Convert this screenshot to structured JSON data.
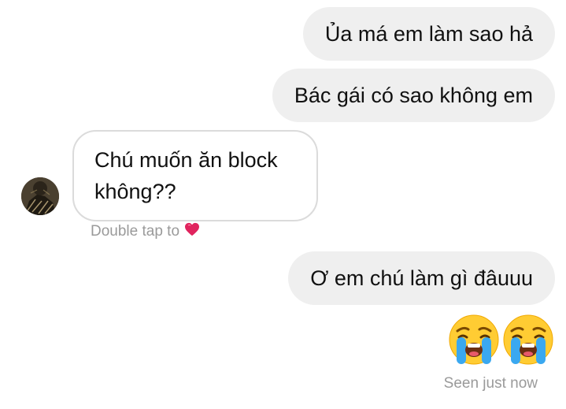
{
  "messages": [
    {
      "direction": "out",
      "text": "Ủa má em làm sao hả"
    },
    {
      "direction": "out",
      "text": "Bác gái có sao không em"
    },
    {
      "direction": "in",
      "text": "Chú muốn ăn block không??"
    },
    {
      "direction": "out",
      "text": "Ơ em chú làm gì đâuuu"
    },
    {
      "direction": "out",
      "emoji": [
        "crying-face-emoji",
        "crying-face-emoji"
      ]
    }
  ],
  "double_tap_hint": "Double tap to",
  "hint_icon": "heart-icon",
  "seen_status": "Seen just now",
  "colors": {
    "outgoing_bubble": "#efefef",
    "incoming_border": "#dbdbdb",
    "meta_text": "#9a9a9a",
    "heart": "#e0245e"
  }
}
